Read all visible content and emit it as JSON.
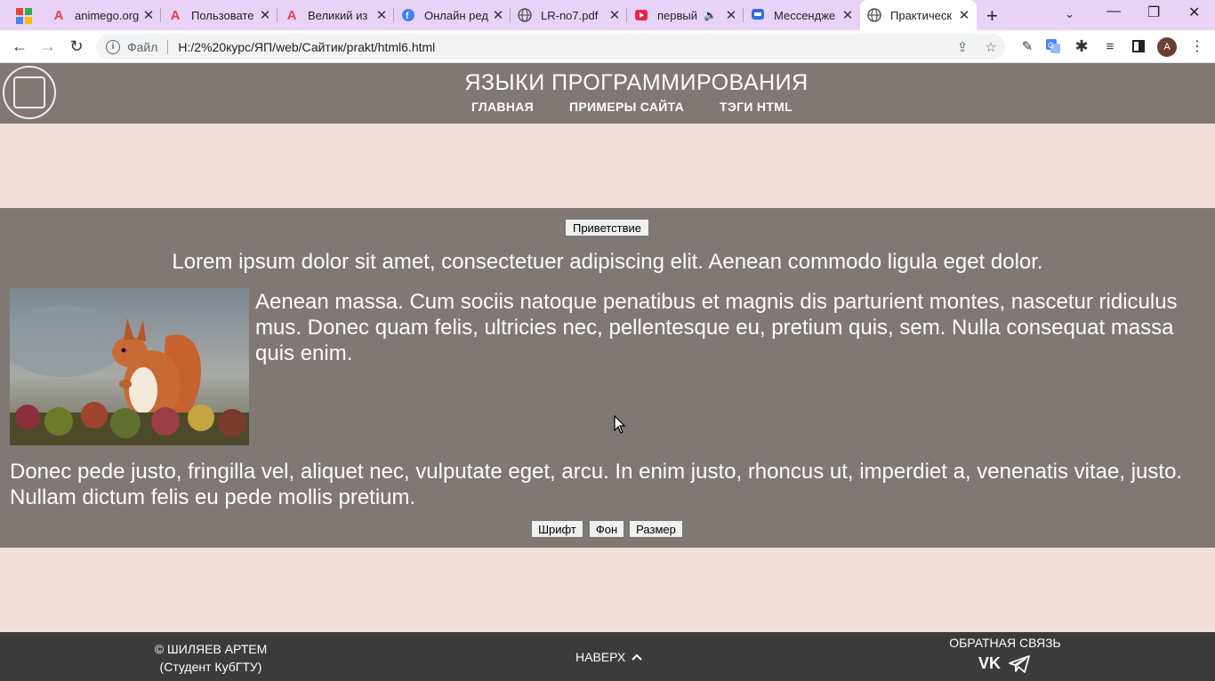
{
  "browser": {
    "tabs": [
      {
        "title": "animego.org",
        "favicon": "letter-a-icon",
        "color": "#e8424b"
      },
      {
        "title": "Пользовате",
        "favicon": "letter-a-icon",
        "color": "#e8424b"
      },
      {
        "title": "Великий из",
        "favicon": "letter-a-icon",
        "color": "#e8424b"
      },
      {
        "title": "Онлайн ред",
        "favicon": "editor-icon",
        "color": "#3b82f6"
      },
      {
        "title": "LR-no7.pdf",
        "favicon": "globe-icon",
        "color": "#555555"
      },
      {
        "title": "первый",
        "favicon": "video-icon",
        "color": "#e8244b"
      },
      {
        "title": "Мессендже",
        "favicon": "chat-icon",
        "color": "#2a6fe0"
      },
      {
        "title": "Практическ",
        "favicon": "globe-icon",
        "color": "#555555"
      }
    ],
    "address": {
      "scheme_label": "Файл",
      "url": "H:/2%20курс/ЯП/web/Сайтик/prakt/html6.html"
    },
    "profile_initial": "A"
  },
  "site": {
    "title": "ЯЗЫКИ ПРОГРАММИРОВАНИЯ",
    "nav": [
      "ГЛАВНАЯ",
      "ПРИМЕРЫ САЙТА",
      "ТЭГИ HTML"
    ]
  },
  "main": {
    "greet_button": "Приветствие",
    "lead": "Lorem ipsum dolor sit amet, consectetuer adipiscing elit. Aenean commodo ligula eget dolor.",
    "paragraph2": "Aenean massa. Cum sociis natoque penatibus et magnis dis parturient montes, nascetur ridiculus mus. Donec quam felis, ultricies nec, pellentesque eu, pretium quis, sem. Nulla consequat massa quis enim.",
    "paragraph3": "Donec pede justo, fringilla vel, aliquet nec, vulputate eget, arcu. In enim justo, rhoncus ut, imperdiet a, venenatis vitae, justo. Nullam dictum felis eu pede mollis pretium.",
    "buttons": {
      "font": "Шрифт",
      "background": "Фон",
      "size": "Размер"
    }
  },
  "footer": {
    "author": "© ШИЛЯЕВ АРТЕМ",
    "author_sub": "(Студент КубГТУ)",
    "to_top": "НАВЕРХ",
    "feedback": "ОБРАТНАЯ СВЯЗЬ",
    "vk": "VK"
  },
  "colors": {
    "page_bg": "#f3dfd9",
    "panel_bg": "#807875",
    "footer_bg": "#3b3b3b",
    "tabstrip_bg": "#e8d3f7"
  }
}
